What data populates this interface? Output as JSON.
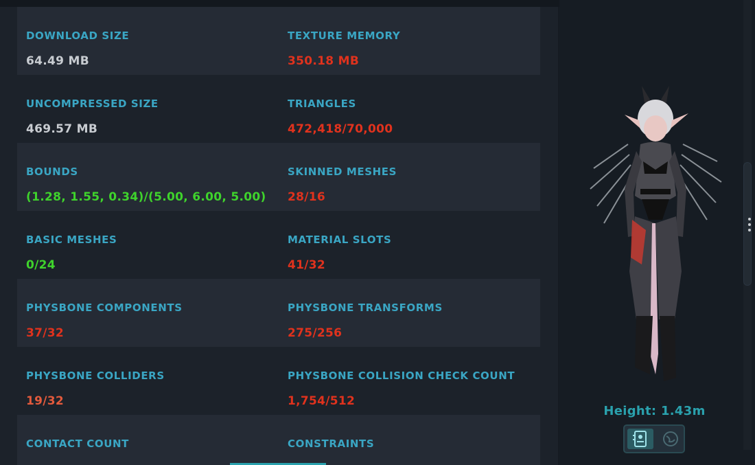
{
  "stats": [
    {
      "left": {
        "label": "DOWNLOAD SIZE",
        "value": "64.49 MB",
        "status": "neutral"
      },
      "right": {
        "label": "TEXTURE MEMORY",
        "value": "350.18 MB",
        "status": "bad"
      }
    },
    {
      "left": {
        "label": "UNCOMPRESSED SIZE",
        "value": "469.57 MB",
        "status": "neutral"
      },
      "right": {
        "label": "TRIANGLES",
        "value": "472,418/70,000",
        "status": "bad"
      }
    },
    {
      "left": {
        "label": "BOUNDS",
        "value": "(1.28, 1.55, 0.34)/(5.00, 6.00, 5.00)",
        "status": "good"
      },
      "right": {
        "label": "SKINNED MESHES",
        "value": "28/16",
        "status": "bad"
      }
    },
    {
      "left": {
        "label": "BASIC MESHES",
        "value": "0/24",
        "status": "good"
      },
      "right": {
        "label": "MATERIAL SLOTS",
        "value": "41/32",
        "status": "bad"
      }
    },
    {
      "left": {
        "label": "PHYSBONE COMPONENTS",
        "value": "37/32",
        "status": "bad"
      },
      "right": {
        "label": "PHYSBONE TRANSFORMS",
        "value": "275/256",
        "status": "bad"
      }
    },
    {
      "left": {
        "label": "PHYSBONE COLLIDERS",
        "value": "19/32",
        "status": "bad"
      },
      "right": {
        "label": "PHYSBONE COLLISION CHECK COUNT",
        "value": "1,754/512",
        "status": "bad"
      }
    },
    {
      "left": {
        "label": "CONTACT COUNT",
        "value": "",
        "status": "neutral"
      },
      "right": {
        "label": "CONSTRAINTS",
        "value": "",
        "status": "bad"
      }
    }
  ],
  "preview": {
    "height_text": "Height: 1.43m",
    "view_toggle": {
      "active": "id-card-icon",
      "inactive": "globe-icon"
    }
  },
  "colors": {
    "label": "#3aa6c4",
    "neutral": "#c8ccd1",
    "bad": "#e0321d",
    "good": "#3fd32c",
    "accent": "#2aa1ad"
  }
}
